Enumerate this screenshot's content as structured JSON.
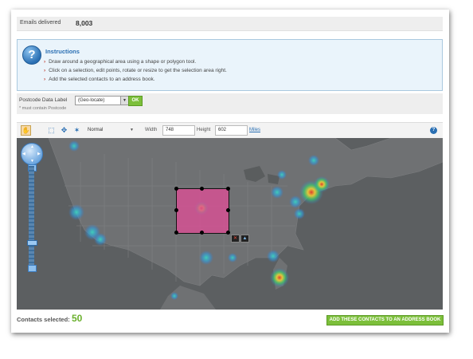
{
  "emails": {
    "label": "Emails delivered",
    "value": "8,003"
  },
  "instructions": {
    "title": "Instructions",
    "items": [
      "Draw around a geographical area using a shape or polygon tool.",
      "Click on a selection, edit points, rotate or resize to get the selection area right.",
      "Add the selected contacts to an address book."
    ]
  },
  "postcode": {
    "label": "Postcode Data Label",
    "note": "* must contain Postcode",
    "selected": "(Geo-locate)",
    "ok_label": "OK"
  },
  "toolbar": {
    "mode": "Normal",
    "width_label": "Width",
    "width_value": "748",
    "height_label": "Height",
    "height_value": "602",
    "units_link": "Miles"
  },
  "footer": {
    "contacts_label": "Contacts selected:",
    "contacts_count": "50",
    "add_button": "ADD THESE CONTACTS TO AN ADDRESS BOOK"
  },
  "colors": {
    "accent_green": "#7cbf3a",
    "selection": "#de4e96",
    "map_bg": "#5a5d5e",
    "link_blue": "#2a6fb3"
  }
}
